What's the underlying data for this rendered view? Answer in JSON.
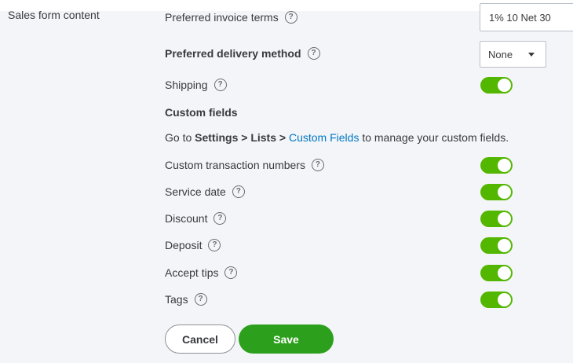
{
  "section": {
    "label": "Sales form content"
  },
  "invoice_terms": {
    "label": "Preferred invoice terms",
    "value": "1% 10 Net 30"
  },
  "delivery": {
    "label": "Preferred delivery method",
    "value": "None"
  },
  "shipping": {
    "label": "Shipping",
    "enabled": true
  },
  "custom_fields": {
    "heading": "Custom fields",
    "info_prefix": "Go to ",
    "info_path": "Settings > Lists > ",
    "info_link": "Custom Fields",
    "info_suffix": " to manage your custom fields."
  },
  "toggles": [
    {
      "label": "Custom transaction numbers",
      "enabled": true
    },
    {
      "label": "Service date",
      "enabled": true
    },
    {
      "label": "Discount",
      "enabled": true
    },
    {
      "label": "Deposit",
      "enabled": true
    },
    {
      "label": "Accept tips",
      "enabled": true
    },
    {
      "label": "Tags",
      "enabled": true
    }
  ],
  "help_glyph": "?",
  "buttons": {
    "cancel": "Cancel",
    "save": "Save"
  },
  "colors": {
    "toggle_on": "#53b700",
    "save": "#2ca01c",
    "link": "#0077c5"
  }
}
